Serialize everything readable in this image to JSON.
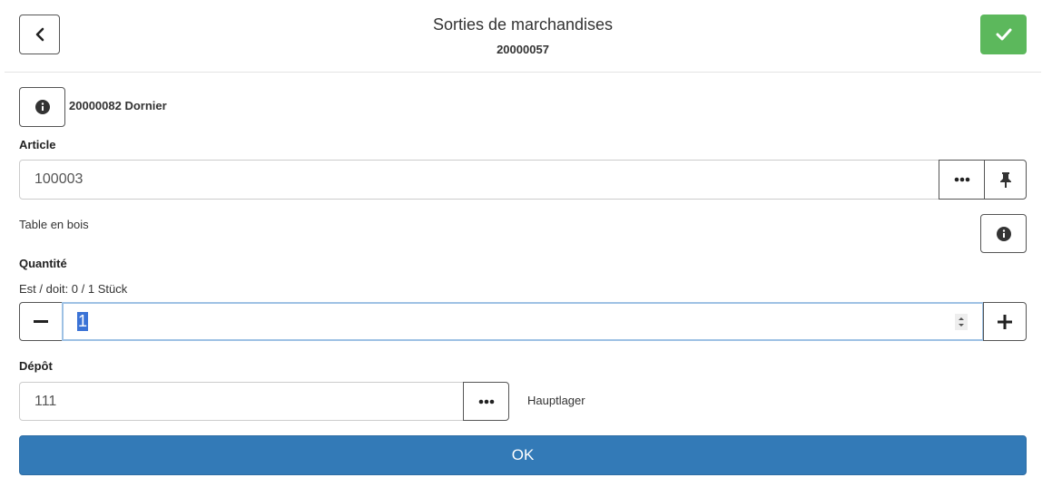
{
  "header": {
    "title": "Sorties de marchandises",
    "subtitle": "20000057"
  },
  "document": {
    "label": "20000082 Dornier"
  },
  "article": {
    "label": "Article",
    "value": "100003",
    "description": "Table en bois"
  },
  "quantity": {
    "label": "Quantité",
    "status": "Est / doit: 0 / 1 Stück",
    "value": "1"
  },
  "depot": {
    "label": "Dépôt",
    "value": "111",
    "name": "Hauptlager"
  },
  "actions": {
    "ok_label": "OK"
  },
  "colors": {
    "confirm": "#5cb85c",
    "primary": "#337ab7",
    "selection": "#3b73d6"
  },
  "icons": [
    "chevron-left-icon",
    "check-icon",
    "info-icon",
    "ellipsis-icon",
    "pin-icon",
    "minus-icon",
    "plus-icon"
  ]
}
